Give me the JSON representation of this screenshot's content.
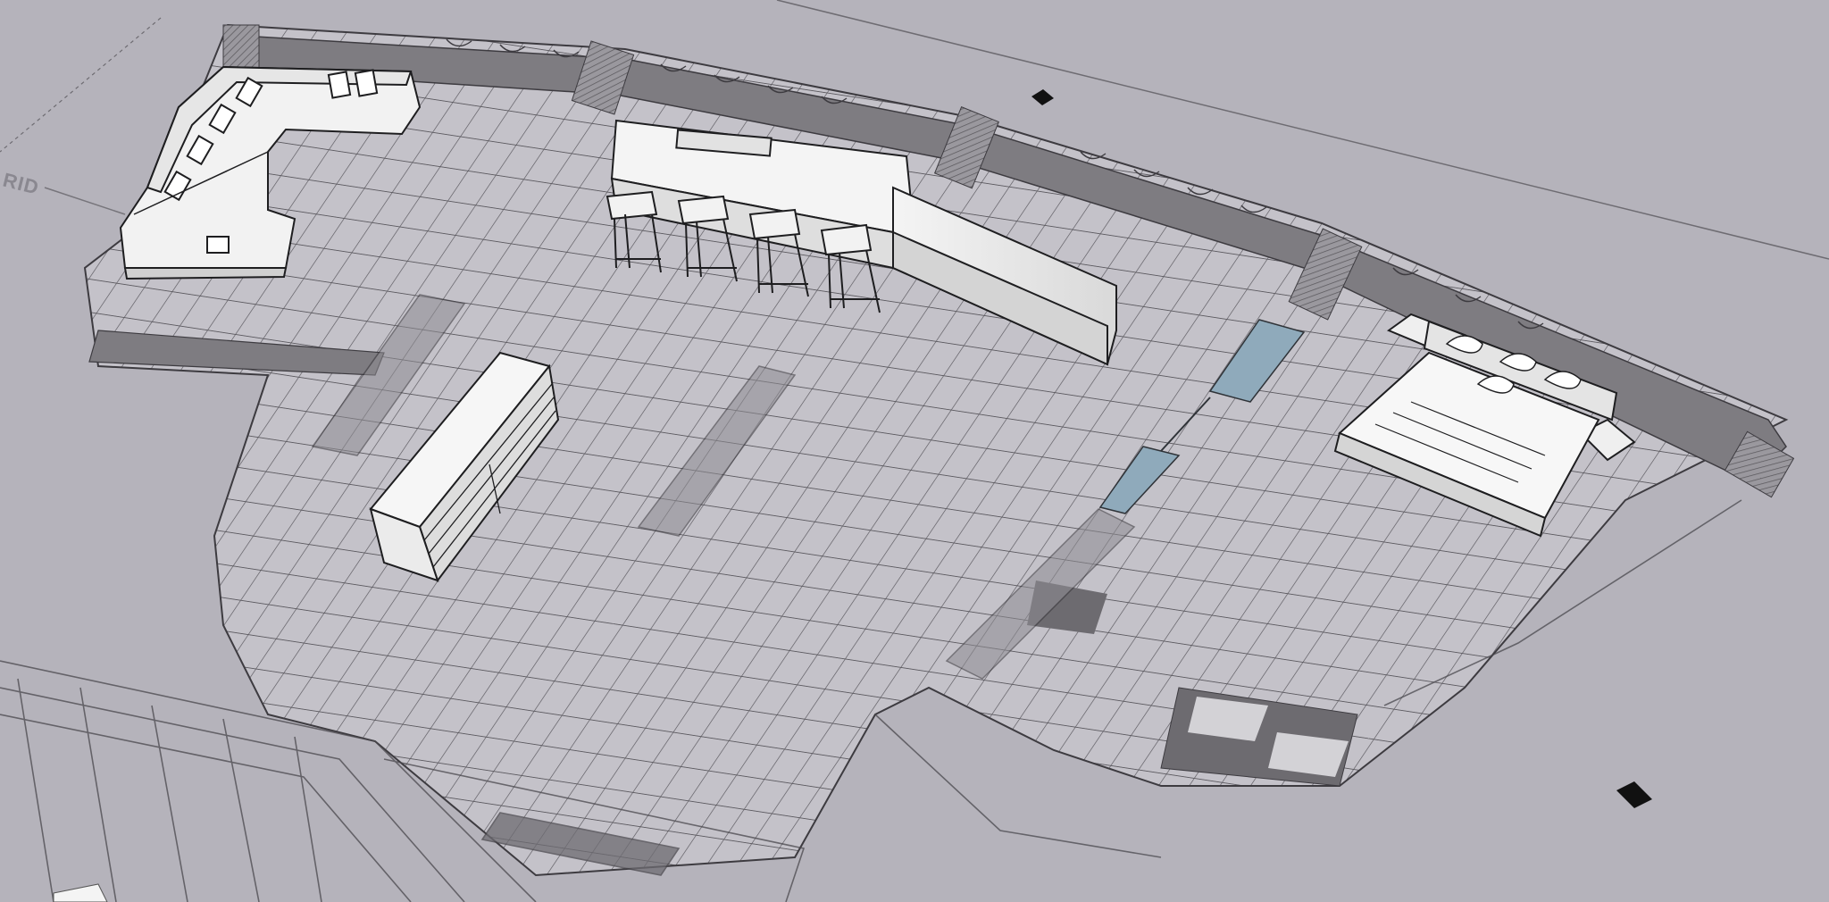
{
  "app": {
    "window_title": ""
  },
  "scene": {
    "grid_label": "RID",
    "background_color": "#b5b3bb",
    "floor_color": "#c4c2c9",
    "wall_band_color": "#7d7b80",
    "furniture_fill": "#f2f2f2",
    "glass_color": "#8faabb",
    "objects": [
      {
        "name": "sectional-sofa",
        "kind": "furniture"
      },
      {
        "name": "kitchen-island-with-bar-stools",
        "kind": "furniture"
      },
      {
        "name": "sideboard-cabinet",
        "kind": "furniture"
      },
      {
        "name": "double-bed-with-nightstands",
        "kind": "furniture"
      },
      {
        "name": "glass-partition",
        "kind": "wall"
      },
      {
        "name": "column-ghost",
        "kind": "structure"
      }
    ]
  }
}
